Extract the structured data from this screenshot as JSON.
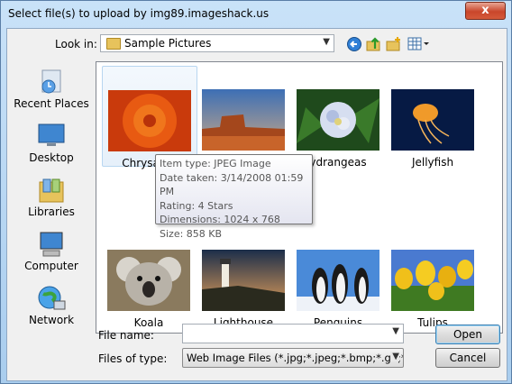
{
  "window": {
    "title": "Select file(s) to upload by img89.imageshack.us",
    "close_label": "x"
  },
  "lookin": {
    "label": "Look in:",
    "value": "Sample Pictures"
  },
  "places": [
    {
      "label": "Recent Places",
      "icon": "recent-places-icon"
    },
    {
      "label": "Desktop",
      "icon": "desktop-icon"
    },
    {
      "label": "Libraries",
      "icon": "libraries-icon"
    },
    {
      "label": "Computer",
      "icon": "computer-icon"
    },
    {
      "label": "Network",
      "icon": "network-icon"
    }
  ],
  "files": [
    {
      "name": "Chrysanth",
      "icon": "chrysanthemum-thumbnail",
      "selected": true
    },
    {
      "name": "",
      "icon": "desert-thumbnail"
    },
    {
      "name": "ydrangeas",
      "icon": "hydrangeas-thumbnail"
    },
    {
      "name": "Jellyfish",
      "icon": "jellyfish-thumbnail"
    },
    {
      "name": "Koala",
      "icon": "koala-thumbnail"
    },
    {
      "name": "Lighthouse",
      "icon": "lighthouse-thumbnail"
    },
    {
      "name": "Penguins",
      "icon": "penguins-thumbnail"
    },
    {
      "name": "Tulips",
      "icon": "tulips-thumbnail"
    }
  ],
  "tooltip": {
    "type": "Item type: JPEG Image",
    "date": "Date taken: 3/14/2008 01:59 PM",
    "rating": "Rating: 4 Stars",
    "dimensions": "Dimensions: 1024 x 768",
    "size": "Size: 858 KB"
  },
  "filename": {
    "label": "File name:",
    "value": ""
  },
  "filetype": {
    "label": "Files of type:",
    "value": "Web Image Files (*.jpg;*.jpeg;*.bmp;*.gif;*.png;*"
  },
  "buttons": {
    "open": "Open",
    "cancel": "Cancel"
  },
  "colors": {
    "accent": "#3c7fb1",
    "close": "#c9462b"
  }
}
